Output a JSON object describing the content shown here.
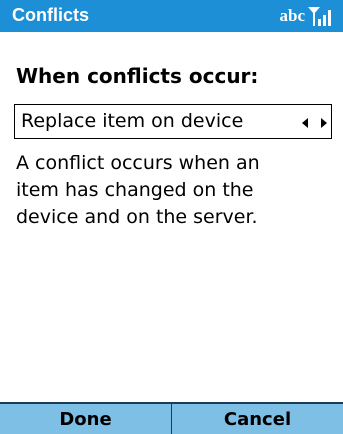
{
  "titlebar": {
    "title": "Conflicts",
    "input_mode": "abc",
    "signal_icon": "signal-strength-icon",
    "background_color": "#1d8fd6"
  },
  "main": {
    "heading": "When conflicts occur:",
    "dropdown_value": "Replace item on device",
    "description_lines": [
      "A conflict occurs when an",
      "item has changed on the",
      "device and on the server."
    ]
  },
  "softkeys": {
    "left_label": "Done",
    "right_label": "Cancel",
    "background_color": "#7ebfe6"
  }
}
